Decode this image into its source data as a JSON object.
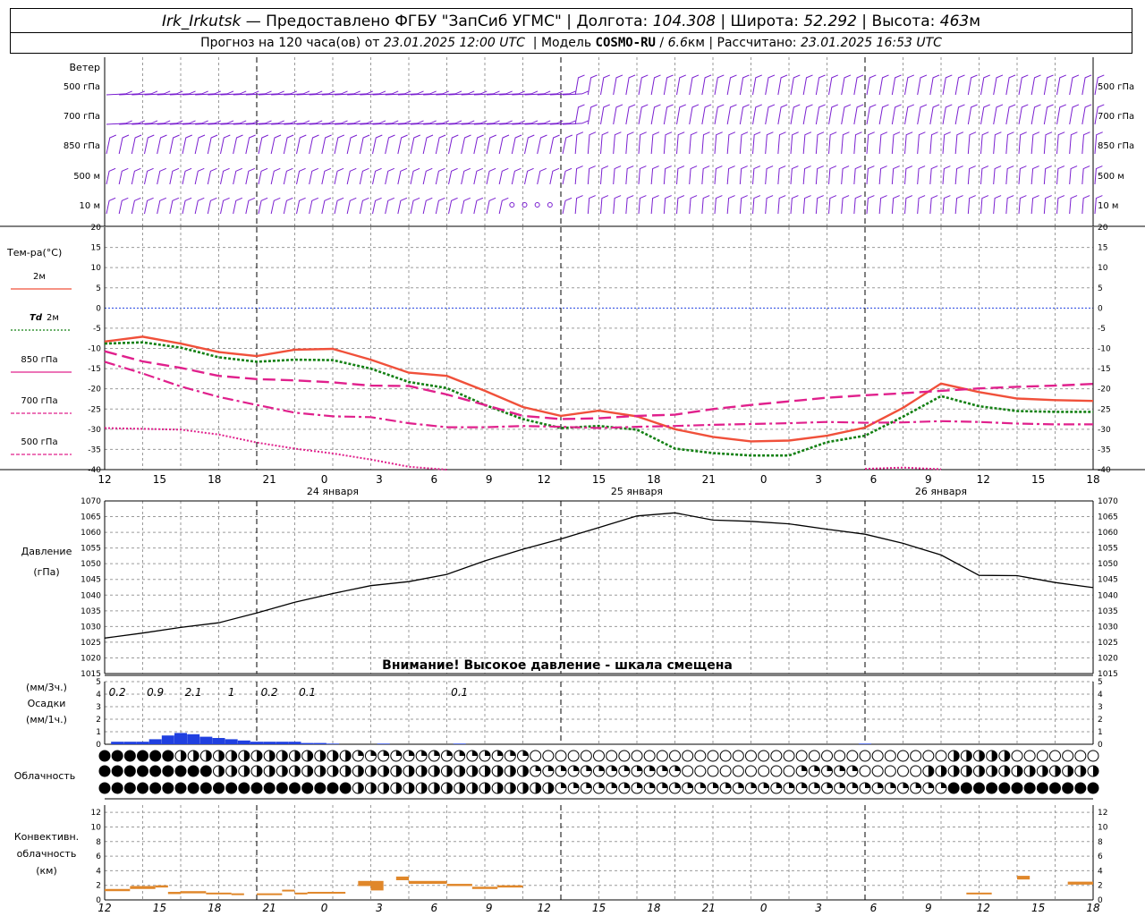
{
  "header": {
    "station": "Irk_Irkutsk",
    "provider": "— Предоставлено ФГБУ \"ЗапСиб УГМС\"",
    "lon_label": "Долгота:",
    "lon": "104.308",
    "lat_label": "Широта:",
    "lat": "52.292",
    "alt_label": "Высота:",
    "alt": "463",
    "alt_unit": "м",
    "forecast_prefix": "Прогноз на 120 часа(ов) от",
    "forecast_time": "23.01.2025 12:00 UTC",
    "model_label": "Модель",
    "model": "COSMO-RU",
    "resolution": "6.6",
    "resolution_unit": "км",
    "calc_label": "Рассчитано:",
    "calc_time": "23.01.2025 16:53 UTC"
  },
  "colors": {
    "wind": "#7a1fd0",
    "t2m": "#f0503a",
    "td2m": "#138013",
    "t850": "#e0208c",
    "grid": "#9a9a9a",
    "pressure": "#000000",
    "precip": "#2040e0",
    "convective": "#e0872a",
    "zero_line": "#2040e0"
  },
  "chart_data": [
    {
      "type": "wind_barbs",
      "ylabel": "Ветер",
      "levels": [
        "500 гПа",
        "700 гПа",
        "850 гПа",
        "500 м",
        "10 м"
      ],
      "hours": [
        12,
        15,
        18,
        21,
        0,
        3,
        6,
        9,
        12,
        15,
        18,
        21,
        0,
        3,
        6,
        9,
        12,
        15,
        18
      ],
      "note": "wind barbs plotted every hour; direction mostly from west-northwest"
    },
    {
      "type": "line",
      "ylabel": "Тем-ра(°C)",
      "ylim": [
        -40,
        20
      ],
      "yticks": [
        20,
        15,
        10,
        5,
        0,
        -5,
        -10,
        -15,
        -20,
        -25,
        -30,
        -35,
        -40
      ],
      "x": [
        0,
        3,
        6,
        9,
        12,
        15,
        18,
        21,
        24,
        27,
        30,
        33,
        36,
        39,
        42,
        45,
        48,
        51,
        54,
        57,
        60,
        63,
        66,
        69,
        72,
        75,
        78
      ],
      "series": [
        {
          "name": "2м",
          "style": "solid",
          "values": [
            -8.3,
            -7.1,
            -8.8,
            -10.9,
            -11.9,
            -10.3,
            -10.1,
            -12.8,
            -16.0,
            -16.8,
            -20.5,
            -24.5,
            -26.7,
            -25.4,
            -26.8,
            -30.0,
            -31.9,
            -33.0,
            -32.8,
            -31.6,
            -29.6,
            -24.7,
            -18.7,
            -20.8,
            -22.4,
            -22.8,
            -23.0
          ]
        },
        {
          "name": "Td 2м",
          "style": "dotted",
          "values": [
            -8.8,
            -8.5,
            -9.8,
            -12.2,
            -13.3,
            -12.8,
            -12.9,
            -15.0,
            -18.3,
            -19.8,
            -24.0,
            -27.5,
            -29.7,
            -29.2,
            -30.1,
            -34.8,
            -35.9,
            -36.5,
            -36.5,
            -33.2,
            -31.6,
            -26.9,
            -21.8,
            -24.3,
            -25.5,
            -25.7,
            -25.7
          ]
        },
        {
          "name": "850 гПа",
          "style": "long-dash",
          "values": [
            -10.7,
            -13.2,
            -14.8,
            -16.8,
            -17.6,
            -17.9,
            -18.4,
            -19.2,
            -19.3,
            -21.4,
            -24.0,
            -26.7,
            -27.5,
            -27.3,
            -26.7,
            -26.4,
            -25.0,
            -24.0,
            -23.1,
            -22.2,
            -21.6,
            -21.1,
            -20.5,
            -19.9,
            -19.5,
            -19.2,
            -18.8
          ]
        },
        {
          "name": "700 гПа",
          "style": "dash-dot",
          "values": [
            -13.3,
            -16.2,
            -19.4,
            -22.0,
            -24.0,
            -25.9,
            -26.8,
            -27.0,
            -28.5,
            -29.5,
            -29.5,
            -29.2,
            -29.4,
            -29.7,
            -29.4,
            -29.2,
            -28.9,
            -28.7,
            -28.5,
            -28.2,
            -28.4,
            -28.3,
            -28.0,
            -28.2,
            -28.6,
            -28.8,
            -28.8
          ]
        },
        {
          "name": "500 гПа",
          "style": "dotted",
          "values": [
            -29.7,
            -29.9,
            -30.1,
            -31.3,
            -33.3,
            -34.8,
            -36.0,
            -37.5,
            -39.3,
            -40.0,
            null,
            null,
            null,
            null,
            null,
            null,
            null,
            null,
            null,
            null,
            -39.8,
            -39.5,
            -39.9,
            null,
            null,
            null,
            null
          ]
        }
      ]
    },
    {
      "type": "line",
      "ylabel": "Давление",
      "yunit": "(гПа)",
      "ylim": [
        1015,
        1070
      ],
      "yticks": [
        1070,
        1065,
        1060,
        1055,
        1050,
        1045,
        1040,
        1035,
        1030,
        1025,
        1020,
        1015
      ],
      "x": [
        0,
        3,
        6,
        9,
        12,
        15,
        18,
        21,
        24,
        27,
        30,
        33,
        36,
        39,
        42,
        45,
        48,
        51,
        54,
        57,
        60,
        63,
        66,
        69,
        72,
        75,
        78
      ],
      "series": [
        {
          "name": "Давление",
          "values": [
            1026.3,
            1027.9,
            1029.7,
            1031.2,
            1034.3,
            1037.7,
            1040.5,
            1043.0,
            1044.3,
            1046.6,
            1050.9,
            1054.6,
            1057.9,
            1061.5,
            1065.2,
            1066.2,
            1063.9,
            1063.5,
            1062.7,
            1061.0,
            1059.4,
            1056.5,
            1052.8,
            1046.3,
            1046.2,
            1044.0,
            1042.4
          ]
        }
      ],
      "annotation": "Внимание! Высокое давление - шкала смещена"
    },
    {
      "type": "bar",
      "ylabel": "(мм/3ч.)",
      "ylabel2": "Осадки",
      "ylabel3": "(мм/1ч.)",
      "ylim": [
        0,
        5
      ],
      "yticks": [
        5,
        4,
        3,
        2,
        1,
        0
      ],
      "totals_3h": [
        {
          "hour": 1,
          "label": "0.2"
        },
        {
          "hour": 4,
          "label": "0.9"
        },
        {
          "hour": 7,
          "label": "2.1"
        },
        {
          "hour": 10,
          "label": "1"
        },
        {
          "hour": 13,
          "label": "0.2"
        },
        {
          "hour": 16,
          "label": "0.1"
        },
        {
          "hour": 28,
          "label": "0.1"
        }
      ],
      "hours": [
        1,
        2,
        3,
        4,
        5,
        6,
        7,
        8,
        9,
        10,
        11,
        12,
        13,
        14,
        15,
        16,
        17,
        18,
        22,
        28,
        60
      ],
      "values_1h": [
        0.2,
        0.2,
        0.2,
        0.4,
        0.7,
        0.9,
        0.8,
        0.6,
        0.5,
        0.4,
        0.3,
        0.2,
        0.2,
        0.2,
        0.2,
        0.1,
        0.1,
        0.05,
        0.05,
        0.05,
        0.05
      ]
    },
    {
      "type": "table",
      "ylabel": "Облачность",
      "rows": 3,
      "columns": 79,
      "note": "cloud cover symbols per hour for three levels; filled circle = overcast, empty = clear"
    },
    {
      "type": "bar",
      "ylabel": "Конвективн.",
      "ylabel2": "облачность",
      "ylabel3": "(км)",
      "ylim": [
        0,
        13
      ],
      "yticks": [
        12,
        10,
        8,
        6,
        4,
        2,
        0
      ],
      "segments": [
        {
          "start": 0,
          "end": 2,
          "base": 1.2,
          "top": 1.5
        },
        {
          "start": 2,
          "end": 4,
          "base": 1.5,
          "top": 1.9
        },
        {
          "start": 4,
          "end": 5,
          "base": 1.7,
          "top": 2.0
        },
        {
          "start": 5,
          "end": 6,
          "base": 0.8,
          "top": 1.1
        },
        {
          "start": 6,
          "end": 8,
          "base": 0.9,
          "top": 1.2
        },
        {
          "start": 8,
          "end": 10,
          "base": 0.8,
          "top": 1.0
        },
        {
          "start": 10,
          "end": 11,
          "base": 0.7,
          "top": 0.9
        },
        {
          "start": 12,
          "end": 14,
          "base": 0.8,
          "top": 0.9
        },
        {
          "start": 14,
          "end": 15,
          "base": 1.2,
          "top": 1.4
        },
        {
          "start": 15,
          "end": 16,
          "base": 0.8,
          "top": 1.0
        },
        {
          "start": 16,
          "end": 19,
          "base": 0.9,
          "top": 1.1
        },
        {
          "start": 20,
          "end": 21,
          "base": 1.9,
          "top": 2.6
        },
        {
          "start": 21,
          "end": 22,
          "base": 1.3,
          "top": 2.6
        },
        {
          "start": 23,
          "end": 24,
          "base": 2.7,
          "top": 3.2
        },
        {
          "start": 24,
          "end": 27,
          "base": 2.2,
          "top": 2.6
        },
        {
          "start": 27,
          "end": 29,
          "base": 1.9,
          "top": 2.2
        },
        {
          "start": 29,
          "end": 31,
          "base": 1.5,
          "top": 1.8
        },
        {
          "start": 31,
          "end": 33,
          "base": 1.7,
          "top": 2.0
        },
        {
          "start": 68,
          "end": 70,
          "base": 0.8,
          "top": 1.0
        },
        {
          "start": 72,
          "end": 73,
          "base": 2.8,
          "top": 3.3
        },
        {
          "start": 76,
          "end": 78,
          "base": 2.1,
          "top": 2.5
        }
      ]
    }
  ],
  "time_axis": {
    "hour_labels": [
      "12",
      "15",
      "18",
      "21",
      "0",
      "3",
      "6",
      "9",
      "12",
      "15",
      "18",
      "21",
      "0",
      "3",
      "6",
      "9",
      "12",
      "15",
      "18"
    ],
    "day_labels": [
      "24 января",
      "25 января",
      "26 января"
    ]
  }
}
